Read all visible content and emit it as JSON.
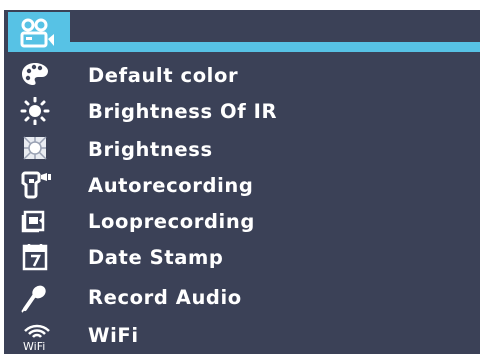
{
  "header": {
    "icon": "video-camera-icon",
    "accent_color": "#57c2e5"
  },
  "menu": {
    "items": [
      {
        "label": "Default color",
        "icon": "palette-icon"
      },
      {
        "label": "Brightness Of IR",
        "icon": "sun-icon"
      },
      {
        "label": "Brightness",
        "icon": "brightness-icon"
      },
      {
        "label": "Autorecording",
        "icon": "auto-record-icon"
      },
      {
        "label": "Looprecording",
        "icon": "loop-record-icon"
      },
      {
        "label": "Date Stamp",
        "icon": "calendar-icon"
      },
      {
        "label": "Record Audio",
        "icon": "microphone-icon"
      },
      {
        "label": "WiFi",
        "icon": "wifi-icon"
      }
    ],
    "wifi_icon_text": "WiFi"
  },
  "colors": {
    "background": "#3b4157",
    "accent": "#57c2e5",
    "text": "#ffffff"
  }
}
